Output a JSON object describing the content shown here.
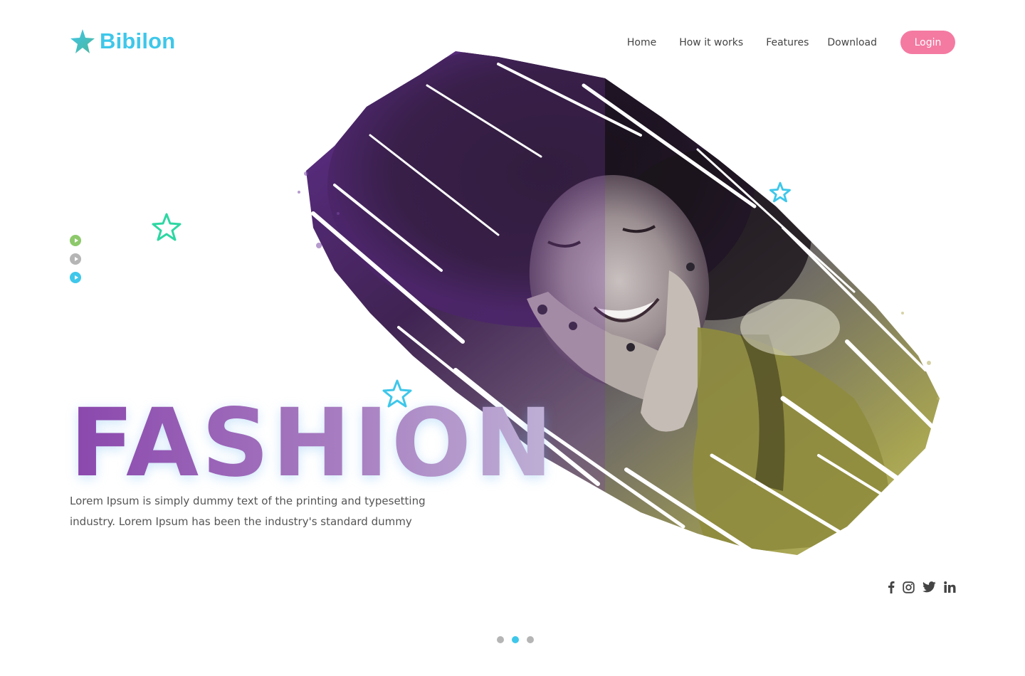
{
  "brand": {
    "name": "Bibilon",
    "color": "#3ec7ea"
  },
  "nav": {
    "items": [
      {
        "label": "Home"
      },
      {
        "label": "How it works"
      },
      {
        "label": "Features"
      },
      {
        "label": "Download"
      }
    ],
    "login_label": "Login",
    "login_color": "#f47aa2"
  },
  "hero": {
    "title": "FASHION",
    "description": "Lorem Ipsum is simply dummy text of the printing and typesetting industry. Lorem Ipsum has been the industry's standard dummy",
    "gradient": [
      "#8a47ad",
      "#bfb1d6"
    ]
  },
  "side_controls": [
    {
      "icon": "play-icon",
      "color": "#8dc96b",
      "active": false
    },
    {
      "icon": "play-icon",
      "color": "#b5b5b5",
      "active": false
    },
    {
      "icon": "play-icon",
      "color": "#3ec7ea",
      "active": true
    }
  ],
  "decorations": {
    "stars": [
      {
        "icon": "star-outline-icon",
        "color": "#2ed7a2"
      },
      {
        "icon": "star-outline-icon",
        "color": "#3ec7ea"
      },
      {
        "icon": "star-outline-icon",
        "color": "#3ec7ea"
      }
    ]
  },
  "social": [
    {
      "icon": "facebook-icon"
    },
    {
      "icon": "instagram-icon"
    },
    {
      "icon": "twitter-icon"
    },
    {
      "icon": "linkedin-icon"
    }
  ],
  "pager": {
    "count": 3,
    "active_index": 1,
    "active_color": "#3ec7ea",
    "inactive_color": "#b5b5b5"
  }
}
